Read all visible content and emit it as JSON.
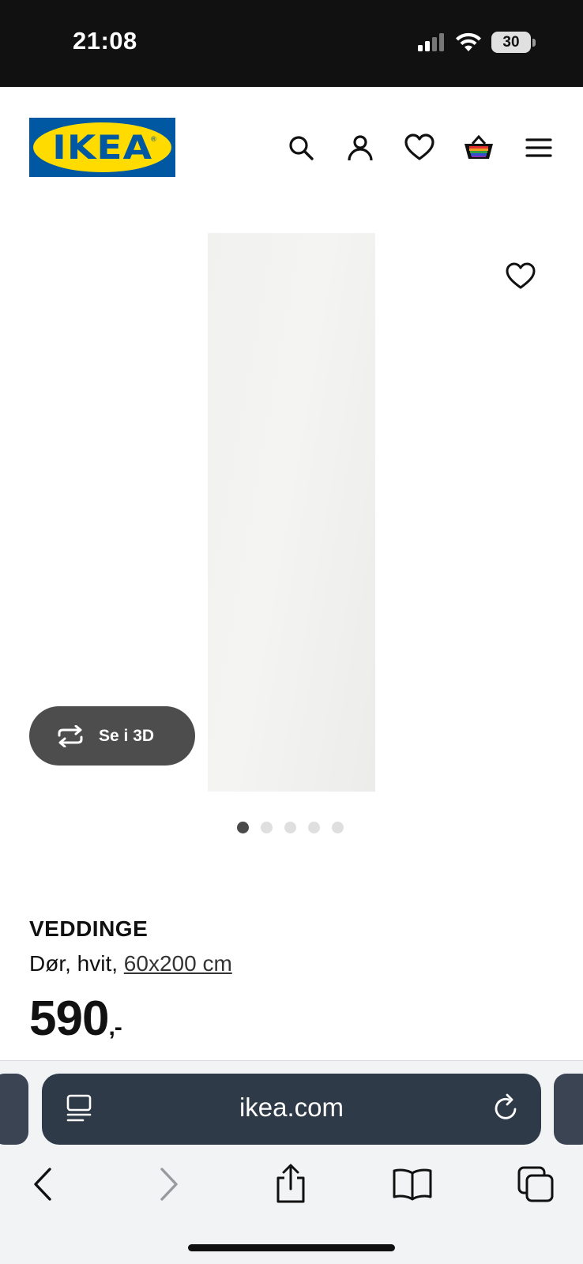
{
  "status_bar": {
    "time": "21:08",
    "battery": "30",
    "icons": [
      "cellular-signal-icon",
      "wifi-icon",
      "battery-icon"
    ]
  },
  "header": {
    "logo_text": "IKEA",
    "logo_registered": "®",
    "icons": [
      "search-icon",
      "account-icon",
      "favourites-icon",
      "shopping-bag-icon",
      "menu-icon"
    ],
    "brand_colors": {
      "blue": "#0058a3",
      "yellow": "#ffdb00"
    }
  },
  "gallery": {
    "view_3d_label": "Se i 3D",
    "dot_count": 5,
    "active_dot": 1
  },
  "product": {
    "name": "VEDDINGE",
    "description_prefix": "Dør, hvit, ",
    "size_link": "60x200 cm",
    "price": "590",
    "price_suffix": ",-"
  },
  "browser": {
    "url": "ikea.com",
    "toolbar": [
      "back-icon",
      "forward-icon",
      "share-icon",
      "bookmarks-icon",
      "tabs-icon"
    ]
  }
}
